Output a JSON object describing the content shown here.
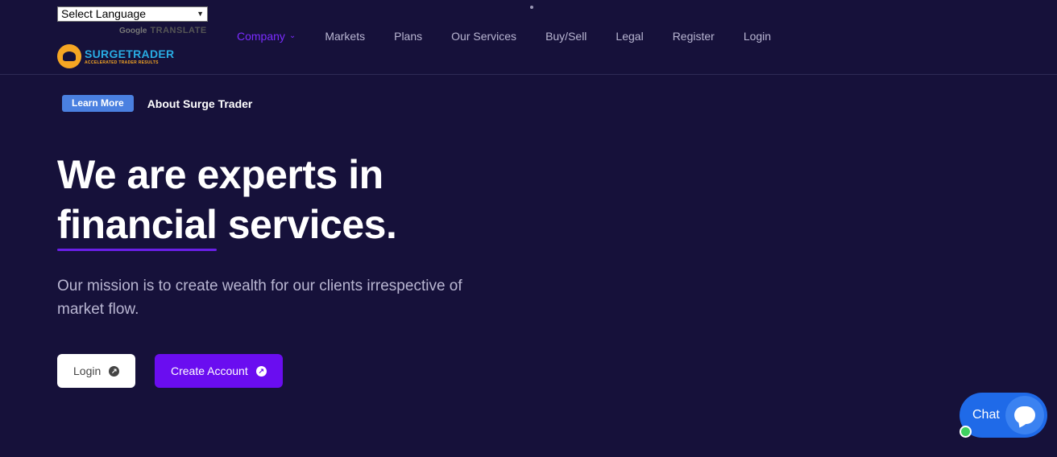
{
  "header": {
    "language_select": "Select Language",
    "powered_by": {
      "google": "Google",
      "translate": "TRANSLATE"
    },
    "logo": {
      "brand": "SURGETRADER",
      "tagline": "ACCELERATED TRADER RESULTS"
    }
  },
  "nav": {
    "items": [
      {
        "label": "Company",
        "active": true
      },
      {
        "label": "Markets"
      },
      {
        "label": "Plans"
      },
      {
        "label": "Our Services"
      },
      {
        "label": "Buy/Sell"
      },
      {
        "label": "Legal"
      },
      {
        "label": "Register"
      },
      {
        "label": "Login"
      }
    ]
  },
  "hero": {
    "badge": "Learn More",
    "badge_text": "About Surge Trader",
    "headline_line1": "We are experts in",
    "headline_highlight": "financial",
    "headline_rest": "services.",
    "mission": "Our mission is to create wealth for our clients irrespective of market flow.",
    "login_button": "Login",
    "create_button": "Create Account"
  },
  "chat": {
    "label": "Chat"
  },
  "colors": {
    "background": "#16113a",
    "accent": "#6a0df0",
    "badge": "#4a80e0",
    "chat": "#1f6ae8"
  },
  "icons": [
    "chevron-down-icon",
    "arrow-up-right-icon",
    "chat-bubble-icon"
  ]
}
